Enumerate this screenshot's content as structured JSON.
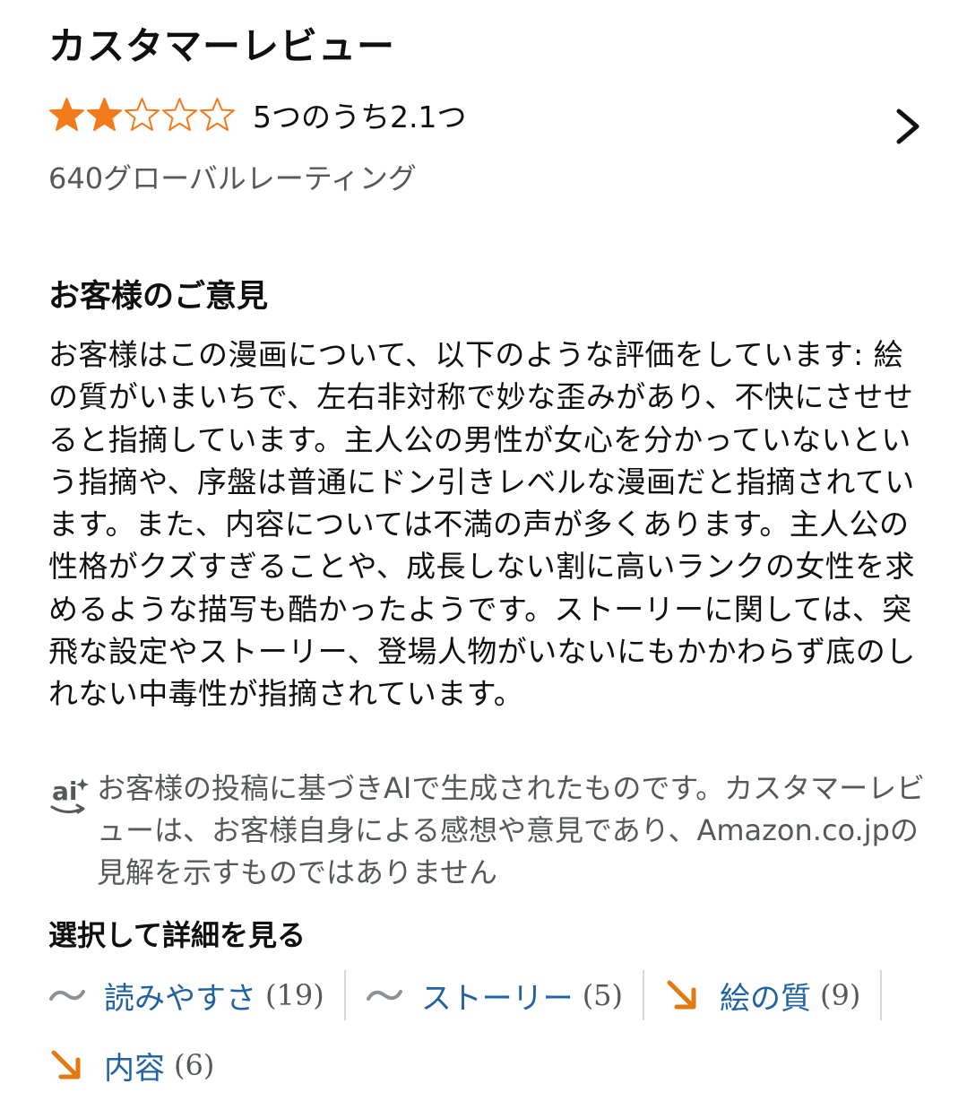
{
  "header": {
    "title": "カスタマーレビュー"
  },
  "rating": {
    "stars_value": 2.1,
    "stars_max": 5,
    "text": "5つのうち2.1つ",
    "global_count": "640グローバルレーティング",
    "star_color": "#f27a1a"
  },
  "opinions": {
    "title": "お客様のご意見",
    "summary": "お客様はこの漫画について、以下のような評価をしています: 絵の質がいまいちで、左右非対称で妙な歪みがあり、不快にさせせると指摘しています。主人公の男性が女心を分かっていないという指摘や、序盤は普通にドン引きレベルな漫画だと指摘されています。また、内容については不満の声が多くあります。主人公の性格がクズすぎることや、成長しない割に高いランクの女性を求めるような描写も酷かったようです。ストーリーに関しては、突飛な設定やストーリー、登場人物がいないにもかかわらず底のしれない中毒性が指摘されています。",
    "ai_icon": "ai-icon",
    "disclaimer": "お客様の投稿に基づきAIで生成されたものです。カスタマーレビューは、お客様自身による感想や意見であり、Amazon.co.jpの見解を示すものではありません"
  },
  "aspects": {
    "title": "選択して詳細を見る",
    "items": [
      {
        "label": "読みやすさ",
        "count": "(19)",
        "trend": "neutral",
        "icon": "tilde-icon"
      },
      {
        "label": "ストーリー",
        "count": "(5)",
        "trend": "neutral",
        "icon": "tilde-icon"
      },
      {
        "label": "絵の質",
        "count": "(9)",
        "trend": "negative",
        "icon": "arrow-down-right-icon"
      },
      {
        "label": "内容",
        "count": "(6)",
        "trend": "negative",
        "icon": "arrow-down-right-icon"
      }
    ],
    "colors": {
      "neutral": "#8d9096",
      "negative": "#e47911",
      "link": "#2162a1"
    }
  }
}
